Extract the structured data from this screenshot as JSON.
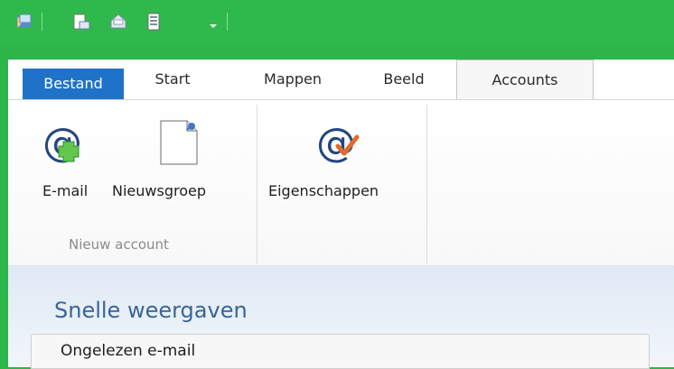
{
  "tabs": {
    "file": "Bestand",
    "start": "Start",
    "folders": "Mappen",
    "view": "Beeld",
    "accounts": "Accounts"
  },
  "ribbon": {
    "email": "E-mail",
    "newsgroup": "Nieuwsgroep",
    "properties": "Eigenschappen",
    "group_new_account": "Nieuw account"
  },
  "main": {
    "title": "Snelle weergaven",
    "row1": "Ongelezen e-mail"
  },
  "icons": {
    "app": "mail-app-icon",
    "new_mail": "new-mail-icon",
    "send_receive": "send-receive-icon",
    "address_book": "address-book-icon",
    "qat_dropdown": "chevron-down-icon",
    "email_account": "at-plus-icon",
    "newsgroup": "document-pin-icon",
    "properties": "at-check-icon"
  },
  "colors": {
    "title_bar": "#2fb84b",
    "file_tab": "#1e73c8",
    "accent_text": "#39649a"
  }
}
